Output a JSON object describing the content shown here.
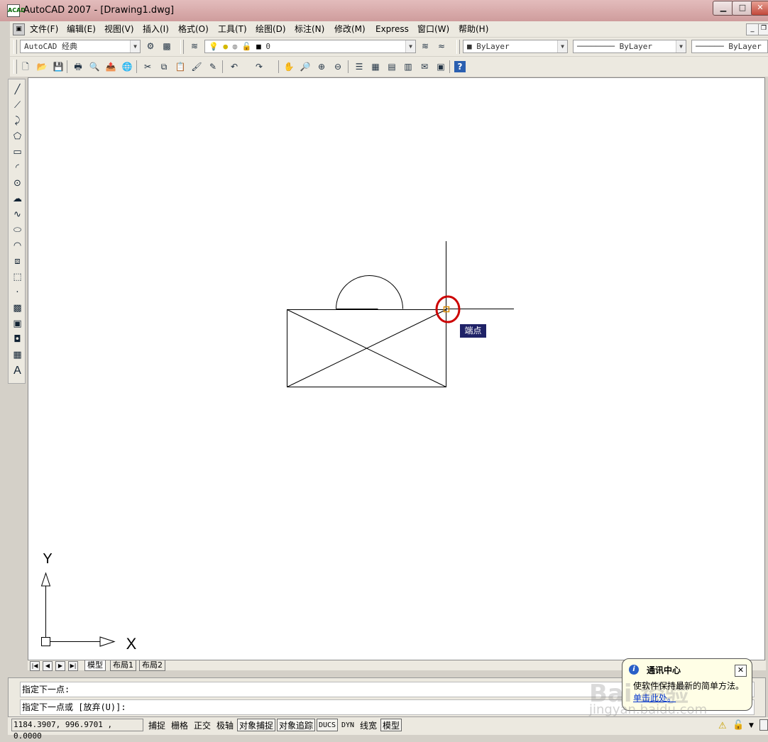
{
  "window": {
    "title": "AutoCAD 2007 - [Drawing1.dwg]",
    "app_icon_text": "ACAD",
    "min_glyph": "▁",
    "max_glyph": "□",
    "close_glyph": "✕"
  },
  "menubar": {
    "items": [
      "文件(F)",
      "编辑(E)",
      "视图(V)",
      "插入(I)",
      "格式(O)",
      "工具(T)",
      "绘图(D)",
      "标注(N)",
      "修改(M)",
      "Express",
      "窗口(W)",
      "帮助(H)"
    ],
    "mdi_min": "_",
    "mdi_restore": "❐"
  },
  "toolbar1": {
    "workspace": "AutoCAD 经典",
    "layer": "0",
    "color": "ByLayer",
    "linetype": "ByLayer",
    "lineweight": "ByLayer",
    "combo_arrow": "▼"
  },
  "toolbar2": {
    "icons": [
      "new-icon",
      "open-icon",
      "save-icon",
      "plot-icon",
      "plot-preview-icon",
      "publish-icon",
      "3d-dwf-icon",
      "cut-icon",
      "copy-icon",
      "paste-icon",
      "match-properties-icon",
      "block-editor-icon",
      "undo-icon",
      "redo-icon",
      "pan-icon",
      "zoom-realtime-icon",
      "zoom-window-icon",
      "zoom-previous-icon",
      "properties-icon",
      "design-center-icon",
      "tool-palettes-icon",
      "sheet-set-icon",
      "markup-icon",
      "quickcalc-icon",
      "help-icon"
    ],
    "glyphs": [
      "🗋",
      "📂",
      "💾",
      "🖶",
      "🔍",
      "📤",
      "🌐",
      "✂",
      "⧉",
      "📋",
      "🖌",
      "✎",
      "↶",
      "↷",
      "✋",
      "🔎",
      "⊕",
      "⊖",
      "☰",
      "▦",
      "▤",
      "▥",
      "✉",
      "▣",
      "?"
    ]
  },
  "draw_toolbar": {
    "icons": [
      "line-icon",
      "construction-line-icon",
      "polyline-icon",
      "polygon-icon",
      "rectangle-icon",
      "arc-icon",
      "circle-icon",
      "revision-cloud-icon",
      "spline-icon",
      "ellipse-icon",
      "ellipse-arc-icon",
      "insert-block-icon",
      "make-block-icon",
      "point-icon",
      "hatch-icon",
      "gradient-icon",
      "region-icon",
      "table-icon",
      "multiline-text-icon"
    ],
    "glyphs": [
      "╱",
      "⟋",
      "⤸",
      "⬠",
      "▭",
      "◜",
      "⊙",
      "☁",
      "∿",
      "⬭",
      "◠",
      "⧈",
      "⬚",
      "·",
      "▩",
      "▣",
      "◘",
      "▦",
      "A"
    ]
  },
  "canvas": {
    "snap_tooltip": "端点",
    "ucs_x": "X",
    "ucs_y": "Y"
  },
  "tabs": {
    "nav": [
      "|◀",
      "◀",
      "▶",
      "▶|"
    ],
    "items": [
      "模型",
      "布局1",
      "布局2"
    ]
  },
  "command": {
    "line1": "指定下一点:",
    "line2": "指定下一点或 [放弃(U)]:"
  },
  "statusbar": {
    "coordinates": "1184.3907, 996.9701 , 0.0000",
    "buttons": [
      {
        "label": "捕捉",
        "on": false
      },
      {
        "label": "栅格",
        "on": false
      },
      {
        "label": "正交",
        "on": false
      },
      {
        "label": "极轴",
        "on": false
      },
      {
        "label": "对象捕捉",
        "on": true
      },
      {
        "label": "对象追踪",
        "on": true
      },
      {
        "label": "DUCS",
        "on": true
      },
      {
        "label": "DYN",
        "on": false
      },
      {
        "label": "线宽",
        "on": false
      },
      {
        "label": "模型",
        "on": true
      }
    ]
  },
  "balloon": {
    "title": "通讯中心",
    "text": "使软件保持最新的简单方法。",
    "link": "单击此处。",
    "close": "✕",
    "info": "i"
  },
  "watermark": {
    "main": "Bai 经验",
    "sub": "jingyan.baidu.com"
  },
  "colors": {
    "title_bar": "#cf9c9c",
    "snap_marker": "#d98a00",
    "highlight_circle": "#cc0000",
    "tooltip_bg": "#1f2267"
  }
}
